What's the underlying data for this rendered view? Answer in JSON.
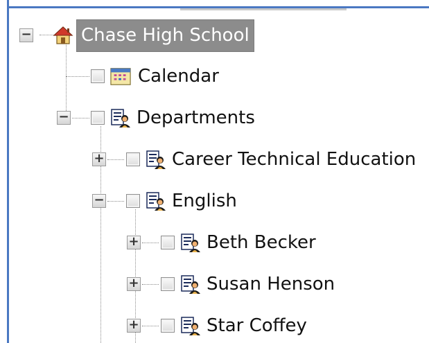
{
  "tree": {
    "root": {
      "label": "Chase High School",
      "expander": "−",
      "icon": "house-icon",
      "selected": true
    },
    "calendar": {
      "label": "Calendar",
      "icon": "calendar-icon"
    },
    "departments": {
      "label": "Departments",
      "expander": "−",
      "icon": "people-list-icon"
    },
    "career_tech": {
      "label": "Career Technical Education",
      "expander": "+",
      "icon": "people-list-icon"
    },
    "english": {
      "label": "English",
      "expander": "−",
      "icon": "people-list-icon"
    },
    "beth_becker": {
      "label": "Beth Becker",
      "expander": "+",
      "icon": "people-list-icon"
    },
    "susan_henson": {
      "label": "Susan Henson",
      "expander": "+",
      "icon": "people-list-icon"
    },
    "star_coffey": {
      "label": "Star Coffey",
      "expander": "+",
      "icon": "people-list-icon"
    }
  },
  "colors": {
    "frame": "#4a78c2",
    "selection_background": "#8c8c8c",
    "selection_text": "#ffffff"
  }
}
